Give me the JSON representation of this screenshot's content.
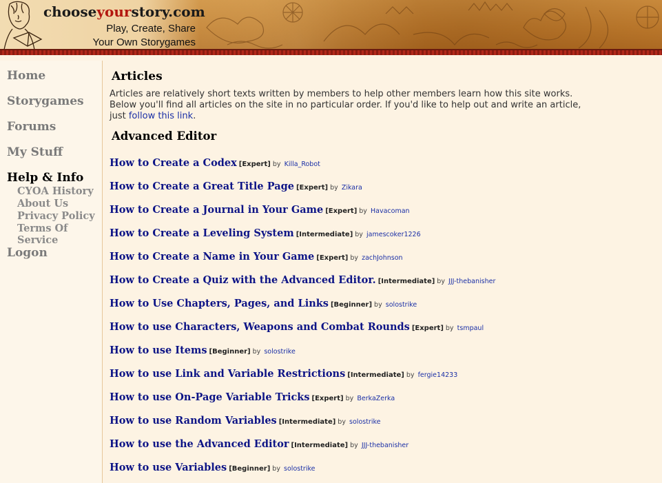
{
  "header": {
    "logo_part1": "choose",
    "logo_part2": "your",
    "logo_part3": "story.com",
    "tagline_line1": "Play, Create, Share",
    "tagline_line2": "Your Own Storygames",
    "brand_red": "#b3170f"
  },
  "sidebar": {
    "items": [
      {
        "label": "Home"
      },
      {
        "label": "Storygames"
      },
      {
        "label": "Forums"
      },
      {
        "label": "My Stuff"
      },
      {
        "label": "Help & Info"
      },
      {
        "label": "Logon"
      }
    ],
    "sub_items": [
      {
        "label": "CYOA History"
      },
      {
        "label": "About Us"
      },
      {
        "label": "Privacy Policy"
      },
      {
        "label": "Terms Of Service"
      }
    ]
  },
  "main": {
    "page_title": "Articles",
    "intro_text": "Articles are relatively short texts written by members to help other members learn how this site works. Below you'll find all articles on the site in no particular order. If you'd like to help out and write an article, just ",
    "intro_link": "follow this link",
    "intro_end": ".",
    "section_title": "Advanced Editor",
    "by_label": "by",
    "articles": [
      {
        "title": "How to Create a Codex",
        "level": "[Expert]",
        "author": "Killa_Robot"
      },
      {
        "title": "How to Create a Great Title Page",
        "level": "[Expert]",
        "author": "Zikara"
      },
      {
        "title": "How to Create a Journal in Your Game",
        "level": "[Expert]",
        "author": "Havacoman"
      },
      {
        "title": "How to Create a Leveling System",
        "level": "[Intermediate]",
        "author": "jamescoker1226"
      },
      {
        "title": "How to Create a Name in Your Game",
        "level": "[Expert]",
        "author": "zachJohnson"
      },
      {
        "title": "How to Create a Quiz with the Advanced Editor.",
        "level": "[Intermediate]",
        "author": "JJJ-thebanisher"
      },
      {
        "title": "How to Use Chapters, Pages, and Links",
        "level": "[Beginner]",
        "author": "solostrike"
      },
      {
        "title": "How to use Characters, Weapons and Combat Rounds",
        "level": "[Expert]",
        "author": "tsmpaul"
      },
      {
        "title": "How to use Items",
        "level": "[Beginner]",
        "author": "solostrike"
      },
      {
        "title": "How to use Link and Variable Restrictions",
        "level": "[Intermediate]",
        "author": "fergie14233"
      },
      {
        "title": "How to use On-Page Variable Tricks",
        "level": "[Expert]",
        "author": "BerkaZerka"
      },
      {
        "title": "How to use Random Variables",
        "level": "[Intermediate]",
        "author": "solostrike"
      },
      {
        "title": "How to use the Advanced Editor",
        "level": "[Intermediate]",
        "author": "JJJ-thebanisher"
      },
      {
        "title": "How to use Variables",
        "level": "[Beginner]",
        "author": "solostrike"
      }
    ]
  }
}
